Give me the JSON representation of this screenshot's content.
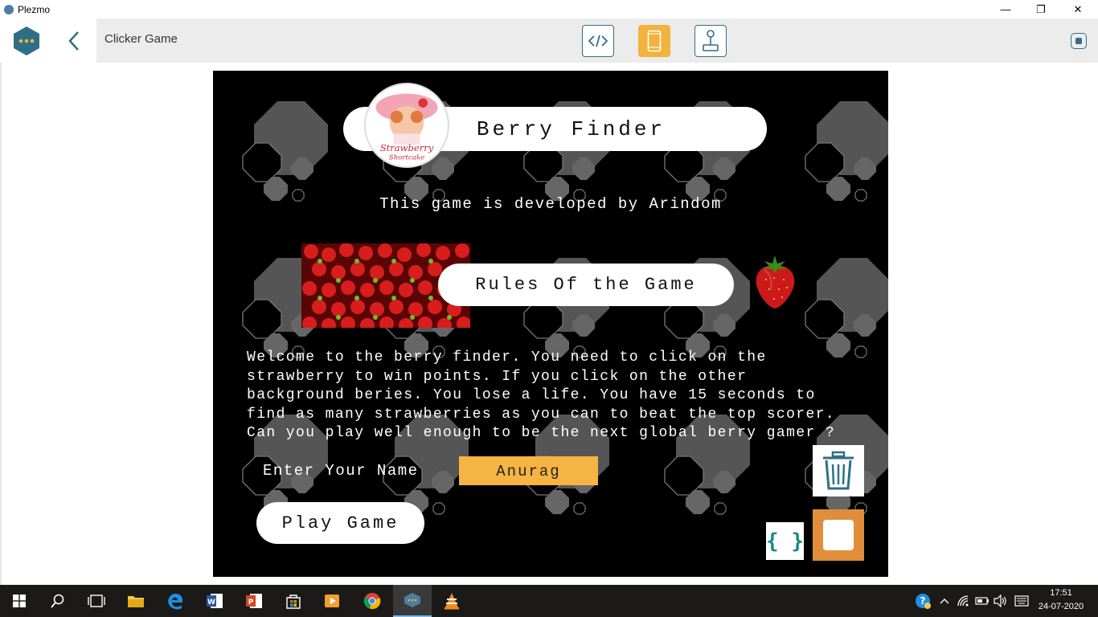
{
  "window": {
    "app_name": "Plezmo",
    "minimize_glyph": "—",
    "restore_glyph": "❐",
    "close_glyph": "✕"
  },
  "toolbar": {
    "project_title": "Clicker Game",
    "modes": [
      {
        "name": "code-mode",
        "icon": "code-icon"
      },
      {
        "name": "app-mode",
        "icon": "phone-icon",
        "active": true
      },
      {
        "name": "controller-mode",
        "icon": "joystick-icon"
      }
    ]
  },
  "stage": {
    "title": "Berry Finder",
    "developer_line": "This game is developed by Arindom",
    "rules_heading": "Rules Of the Game",
    "rules_text": "Welcome to the berry finder. You need to click on the\nstrawberry to win points. If you click on the other\nbackground beries. You lose a life. You have 15 seconds to\nfind as many strawberries as you can to beat the top scorer.\nCan you play well enough to be the next global berry gamer ?",
    "name_label": "Enter Your Name",
    "name_value": "Anurag",
    "play_button": "Play Game",
    "code_glyph": "{ }",
    "logo_text": "Strawberry Shortcake"
  },
  "taskbar": {
    "time": "17:51",
    "date": "24-07-2020"
  },
  "colors": {
    "accent_teal": "#2f6f86",
    "accent_orange": "#f2b33c",
    "input_orange": "#f5b443",
    "stop_orange": "#e08e3a",
    "stage_bg": "#000000"
  }
}
